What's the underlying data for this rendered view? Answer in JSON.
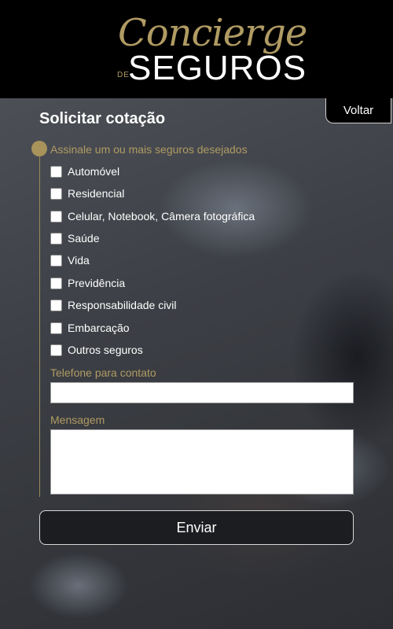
{
  "brand": {
    "script": "Concierge",
    "small": "DE",
    "main": "SEGUROS",
    "accent_color": "#b09b63"
  },
  "nav": {
    "back_label": "Voltar"
  },
  "form": {
    "title": "Solicitar cotação",
    "insurance_prompt": "Assinale um ou mais seguros desejados",
    "options": [
      {
        "label": "Automóvel",
        "checked": false
      },
      {
        "label": "Residencial",
        "checked": false
      },
      {
        "label": "Celular, Notebook, Câmera fotográfica",
        "checked": false
      },
      {
        "label": "Saúde",
        "checked": false
      },
      {
        "label": "Vida",
        "checked": false
      },
      {
        "label": "Previdência",
        "checked": false
      },
      {
        "label": "Responsabilidade civil",
        "checked": false
      },
      {
        "label": "Embarcação",
        "checked": false
      },
      {
        "label": "Outros seguros",
        "checked": false
      }
    ],
    "phone_label": "Telefone para contato",
    "phone_value": "",
    "message_label": "Mensagem",
    "message_value": "",
    "submit_label": "Enviar"
  }
}
